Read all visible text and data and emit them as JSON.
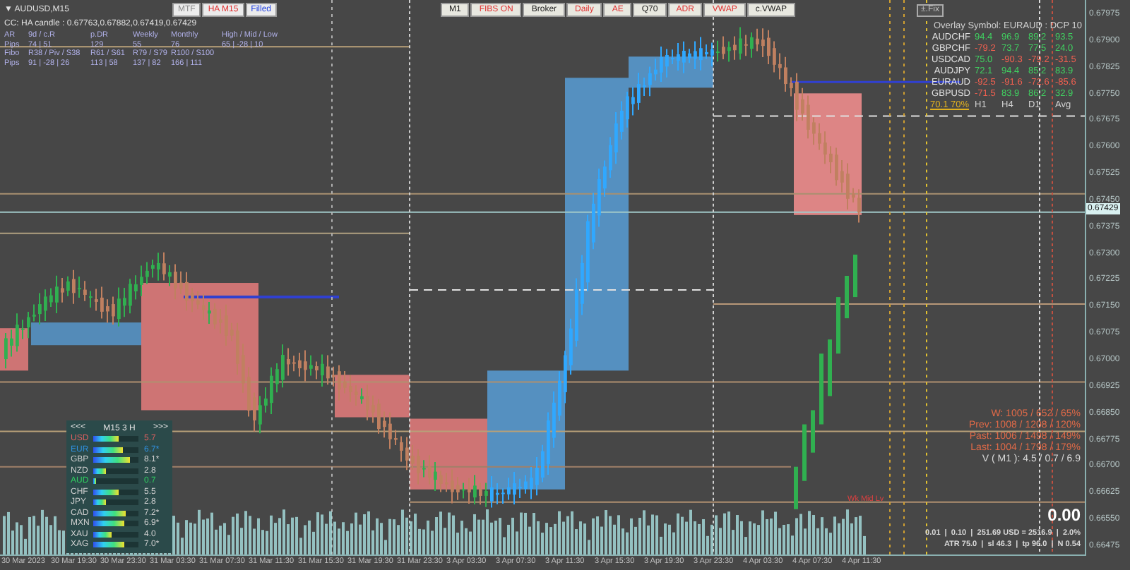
{
  "symbol_title": {
    "glyph": "▼",
    "text": "AUDUSD,M15"
  },
  "mode_buttons": [
    {
      "label": "MTF",
      "color": "#8a8a8a"
    },
    {
      "label": "HA M15",
      "color": "#e03030"
    },
    {
      "label": "Filled",
      "color": "#2040e0"
    }
  ],
  "candle_info": "CC: HA candle : 0.67763,0.67882,0.67419,0.67429",
  "range_table": {
    "rows": [
      {
        "cells": [
          "AR",
          "9d / c.R",
          "p.DR",
          "Weekly",
          "Monthly",
          "High / Mid / Low"
        ]
      },
      {
        "cells": [
          "Pips",
          "74 | 51",
          "129",
          "55",
          "76",
          "65 | -28 | 10"
        ]
      },
      {
        "cells": [
          "Fibo",
          "R38 / Piv / S38",
          "R61 / S61",
          "R79 / S79",
          "R100 / S100"
        ]
      },
      {
        "cells": [
          "Pips",
          "91 | -28 | 26",
          "113 | 58",
          "137 | 82",
          "166 | 111"
        ]
      }
    ]
  },
  "toolbar": [
    {
      "label": "M1",
      "color": "#202020"
    },
    {
      "label": "FIBS ON",
      "color": "#e03030"
    },
    {
      "label": "Broker",
      "color": "#202020"
    },
    {
      "label": "Daily",
      "color": "#e03030"
    },
    {
      "label": "AE",
      "color": "#e03030"
    },
    {
      "label": "Q70",
      "color": "#202020"
    },
    {
      "label": "ADR",
      "color": "#e03030"
    },
    {
      "label": "VWAP",
      "color": "#e03030"
    },
    {
      "label": "c.VWAP",
      "color": "#202020"
    }
  ],
  "fix_button": "±.Fix",
  "overlay": {
    "title": "Overlay Symbol: EURAUD : DCP 10",
    "rows": [
      {
        "symbol": "AUDCHF",
        "values": [
          {
            "text": "94.4",
            "color": "#40d060"
          },
          {
            "text": "96.9",
            "color": "#40d060"
          },
          {
            "text": "89.2",
            "color": "#40d060"
          },
          {
            "text": "93.5",
            "color": "#40d060"
          }
        ]
      },
      {
        "symbol": "GBPCHF",
        "values": [
          {
            "text": "-79.2",
            "color": "#f06050"
          },
          {
            "text": "73.7",
            "color": "#40d060"
          },
          {
            "text": "77.5",
            "color": "#40d060"
          },
          {
            "text": "24.0",
            "color": "#40d060"
          }
        ]
      },
      {
        "symbol": "USDCAD",
        "values": [
          {
            "text": "75.0",
            "color": "#40d060"
          },
          {
            "text": "-90.3",
            "color": "#f06050"
          },
          {
            "text": "-79.2",
            "color": "#f06050"
          },
          {
            "text": "-31.5",
            "color": "#f06050"
          }
        ]
      },
      {
        "symbol": "AUDJPY",
        "values": [
          {
            "text": "72.1",
            "color": "#40d060"
          },
          {
            "text": "94.4",
            "color": "#40d060"
          },
          {
            "text": "85.2",
            "color": "#40d060"
          },
          {
            "text": "83.9",
            "color": "#40d060"
          }
        ]
      },
      {
        "symbol": "EURAUD",
        "values": [
          {
            "text": "-92.5",
            "color": "#f06050"
          },
          {
            "text": "-91.6",
            "color": "#f06050"
          },
          {
            "text": "-72.6",
            "color": "#f06050"
          },
          {
            "text": "-85.6",
            "color": "#f06050"
          }
        ]
      },
      {
        "symbol": "GBPUSD",
        "values": [
          {
            "text": "-71.5",
            "color": "#f06050"
          },
          {
            "text": "83.9",
            "color": "#40d060"
          },
          {
            "text": "86.2",
            "color": "#40d060"
          },
          {
            "text": "32.9",
            "color": "#40d060"
          }
        ]
      }
    ],
    "level": "70.1 70%",
    "columns": [
      "H1",
      "H4",
      "D1",
      "Avg"
    ]
  },
  "price_axis": {
    "labels": [
      "0.67975",
      "0.67900",
      "0.67825",
      "0.67750",
      "0.67675",
      "0.67600",
      "0.67525",
      "0.67450",
      "0.67375",
      "0.67300",
      "0.67225",
      "0.67150",
      "0.67075",
      "0.67000",
      "0.66925",
      "0.66850",
      "0.66775",
      "0.66700",
      "0.66625",
      "0.66550",
      "0.66475"
    ],
    "current": "0.67429"
  },
  "time_axis": [
    "30 Mar 2023",
    "30 Mar 19:30",
    "30 Mar 23:30",
    "31 Mar 03:30",
    "31 Mar 07:30",
    "31 Mar 11:30",
    "31 Mar 15:30",
    "31 Mar 19:30",
    "31 Mar 23:30",
    "3 Apr 03:30",
    "3 Apr 07:30",
    "3 Apr 11:30",
    "3 Apr 15:30",
    "3 Apr 19:30",
    "3 Apr 23:30",
    "4 Apr 03:30",
    "4 Apr 07:30",
    "4 Apr 11:30"
  ],
  "currency_strength": {
    "prev": "<<<",
    "title": "M15 3 H",
    "next": ">>>",
    "rows": [
      {
        "name": "USD",
        "color": "#e06060",
        "level": 0.57,
        "value": "5.7",
        "star": ""
      },
      {
        "name": "EUR",
        "color": "#3090e0",
        "level": 0.67,
        "value": "6.7",
        "star": "*"
      },
      {
        "name": "GBP",
        "color": "#d0d0d0",
        "level": 0.81,
        "value": "8.1",
        "star": "*"
      },
      {
        "name": "NZD",
        "color": "#d0d0d0",
        "level": 0.28,
        "value": "2.8",
        "star": ""
      },
      {
        "name": "AUD",
        "color": "#30d060",
        "level": 0.07,
        "value": "0.7",
        "star": ""
      },
      {
        "name": "CHF",
        "color": "#d0d0d0",
        "level": 0.55,
        "value": "5.5",
        "star": ""
      },
      {
        "name": "JPY",
        "color": "#d0d0d0",
        "level": 0.28,
        "value": "2.8",
        "star": ""
      },
      {
        "name": "CAD",
        "color": "#d0d0d0",
        "level": 0.72,
        "value": "7.2",
        "star": "*"
      },
      {
        "name": "MXN",
        "color": "#d0d0d0",
        "level": 0.69,
        "value": "6.9",
        "star": "*"
      },
      {
        "name": "XAU",
        "color": "#d0d0d0",
        "level": 0.4,
        "value": "4.0",
        "star": ""
      },
      {
        "name": "XAG",
        "color": "#d0d0d0",
        "level": 0.7,
        "value": "7.0",
        "star": "*"
      }
    ]
  },
  "range_stats": [
    "W: 1005 / 652 / 65%",
    "Prev: 1008 / 1208 / 120%",
    "Past: 1006 / 1498 / 149%",
    "Last: 1004 / 1798 / 179%"
  ],
  "volatility": "V ( M1 ): 4.5 / 0.7 / 6.9",
  "profit": "0.00",
  "risk_line": "0.01  |  0.10  |  251.69 USD = 2516.9  |  2.0%",
  "atr_line": "ATR 75.0  |  sl 46.3  |  tp 96.0  |  N 0.54",
  "chart_label": "Wk Mid Lv"
}
